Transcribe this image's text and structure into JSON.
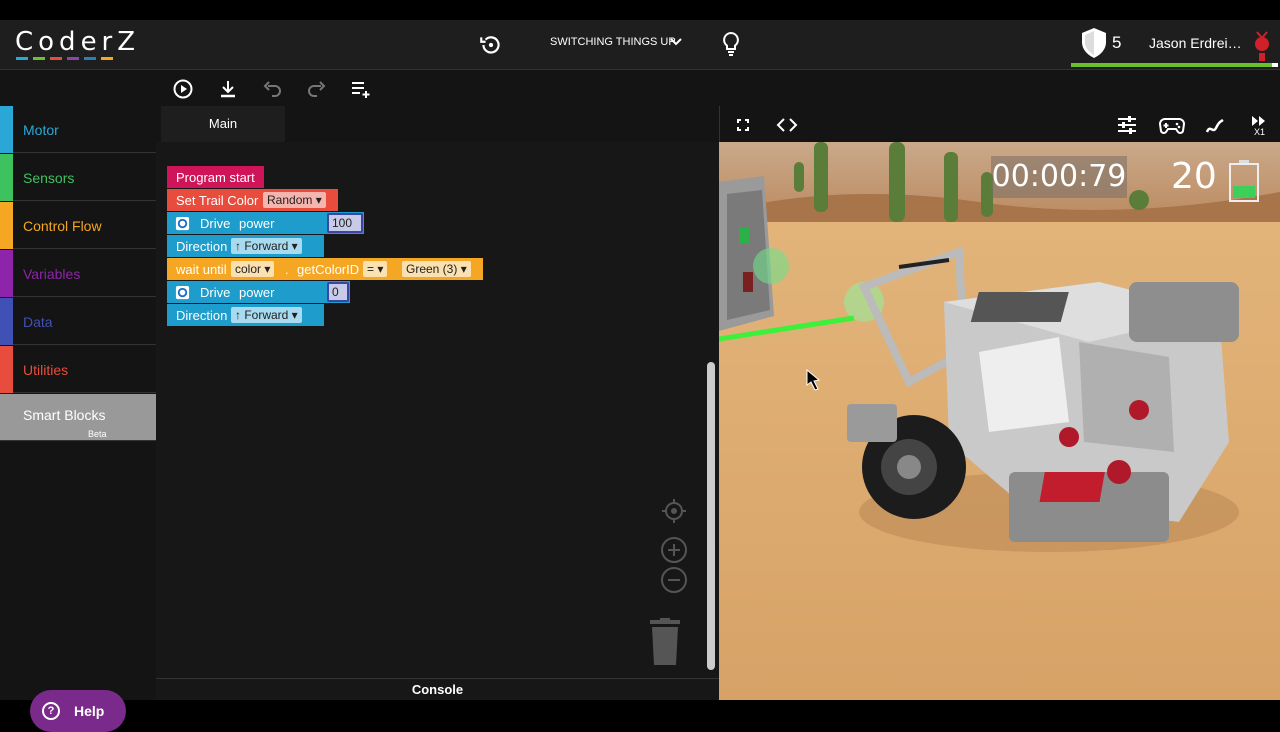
{
  "header": {
    "logo": "CoderZ",
    "logo_colors": [
      "#2aa7d6",
      "#6cc02c",
      "#e84c3d",
      "#8e44ad",
      "#2980b9",
      "#f5a623"
    ],
    "mission_title": "SWITCHING THINGS UP",
    "shield_count": "5",
    "user_name": "Jason Erdrei…",
    "xp_progress": 0.97
  },
  "sidebar": {
    "categories": [
      {
        "label": "Motor",
        "color": "#2aa7d6"
      },
      {
        "label": "Sensors",
        "color": "#3ec25f"
      },
      {
        "label": "Control Flow",
        "color": "#f5a623"
      },
      {
        "label": "Variables",
        "color": "#8e24aa"
      },
      {
        "label": "Data",
        "color": "#3f51b5"
      },
      {
        "label": "Utilities",
        "color": "#e84c3d"
      }
    ],
    "smart_blocks": {
      "label": "Smart Blocks",
      "sub": "Beta"
    },
    "help_label": "Help"
  },
  "editor": {
    "tab": "Main",
    "console_label": "Console",
    "blocks": {
      "program_start": "Program start",
      "set_trail": "Set Trail Color",
      "set_trail_value": "Random",
      "drive1": "Drive",
      "drive1_power": "power",
      "drive1_value": "100",
      "dir1": "Direction",
      "dir1_value": "↑ Forward",
      "wait": "wait until",
      "wait_sensor": "color",
      "wait_dot": ".",
      "wait_prop": "getColorID",
      "wait_op": "=",
      "wait_value": "Green (3)",
      "drive2": "Drive",
      "drive2_power": "power",
      "drive2_value": "0",
      "dir2": "Direction",
      "dir2_value": "↑ Forward"
    }
  },
  "sim": {
    "timer": "00:00:79",
    "score": "20",
    "speed_label": "X1"
  }
}
